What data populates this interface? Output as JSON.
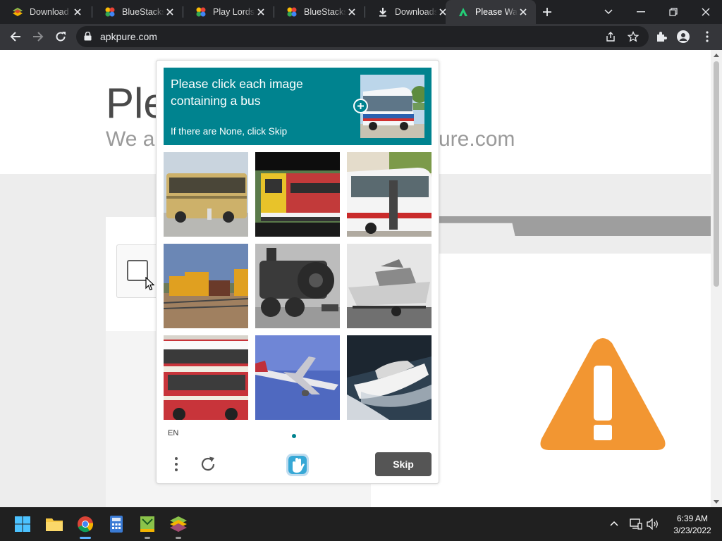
{
  "browser": {
    "tabs": [
      {
        "label": "Download I",
        "icon": "bluestacks-layers-icon"
      },
      {
        "label": "BlueStacks",
        "icon": "bluestacks-ball-icon"
      },
      {
        "label": "Play Lords",
        "icon": "bluestacks-ball-icon"
      },
      {
        "label": "BlueStacks",
        "icon": "bluestacks-ball-icon"
      },
      {
        "label": "Downloads",
        "icon": "download-icon"
      },
      {
        "label": "Please Wai",
        "icon": "apkpure-icon",
        "active": true
      }
    ],
    "url": "apkpure.com"
  },
  "page": {
    "title_partial": "Ple",
    "subtitle_partial": "We ar",
    "subtitle_tail": "ure.com"
  },
  "captcha": {
    "prompt": "Please click each image containing a bus",
    "sub_prompt": "If there are None, click Skip",
    "language": "EN",
    "skip_label": "Skip",
    "accent_color": "#00838f",
    "tiles": [
      {
        "depicts": "bus"
      },
      {
        "depicts": "train"
      },
      {
        "depicts": "bus"
      },
      {
        "depicts": "train"
      },
      {
        "depicts": "train"
      },
      {
        "depicts": "boat"
      },
      {
        "depicts": "bus"
      },
      {
        "depicts": "airplane"
      },
      {
        "depicts": "boat"
      }
    ]
  },
  "taskbar": {
    "time": "6:39 AM",
    "date": "3/23/2022",
    "apps": [
      "start-icon",
      "file-explorer-icon",
      "chrome-icon",
      "calculator-icon",
      "bluestacks-x-icon",
      "bluestacks-icon"
    ]
  }
}
